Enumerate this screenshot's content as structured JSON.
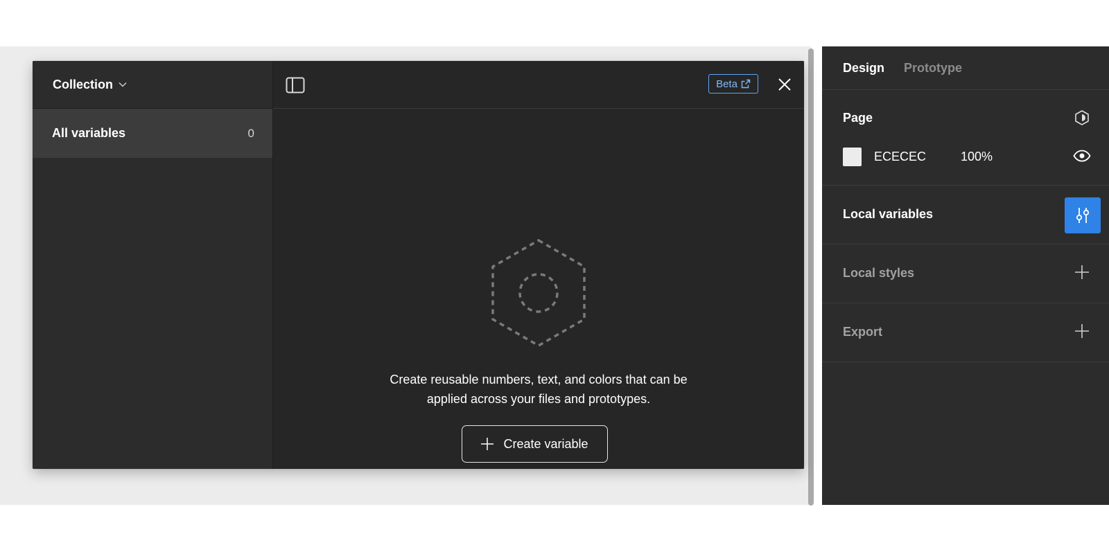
{
  "modal": {
    "collection_label": "Collection",
    "all_variables_label": "All variables",
    "all_variables_count": "0",
    "beta_label": "Beta",
    "empty_line1": "Create reusable numbers, text, and colors that can be",
    "empty_line2": "applied across your files and prototypes.",
    "create_variable_label": "Create variable"
  },
  "design_panel": {
    "tabs": [
      {
        "label": "Design",
        "active": true
      },
      {
        "label": "Prototype",
        "active": false
      }
    ],
    "page": {
      "title": "Page",
      "color": "ECECEC",
      "opacity": "100%"
    },
    "local_variables": "Local variables",
    "local_styles": "Local styles",
    "export": "Export"
  },
  "colors": {
    "accent": "#2f82e6",
    "beta": "#5fa8f5",
    "panel_bg": "#2c2c2c",
    "canvas_bg": "#ececec"
  },
  "icons": {
    "chevron": "chevron-down-icon",
    "sidebar": "sidebar-toggle-icon",
    "external": "external-link-icon",
    "close": "close-icon",
    "empty": "hexagon-placeholder-icon",
    "plus": "plus-icon",
    "eye": "eye-icon",
    "page_style": "page-style-icon",
    "variables": "sliders-icon"
  }
}
